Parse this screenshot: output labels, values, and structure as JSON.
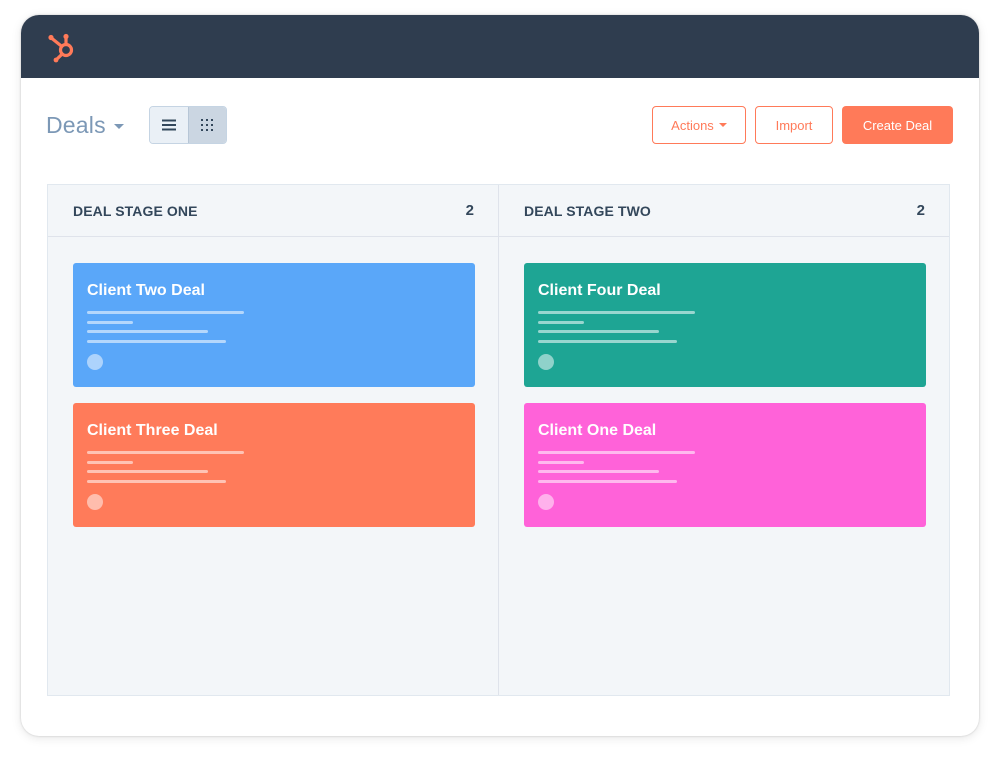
{
  "app": {
    "brand_color": "#ff7a59",
    "logo_icon": "hubspot-sprocket-icon",
    "topbar_color": "#2f3d4f"
  },
  "header": {
    "title": "Deals",
    "view_modes": [
      {
        "icon": "list-view-icon",
        "active": false
      },
      {
        "icon": "grid-view-icon",
        "active": true
      }
    ]
  },
  "toolbar": {
    "actions_label": "Actions",
    "import_label": "Import",
    "create_label": "Create Deal"
  },
  "columns": [
    {
      "title": "DEAL STAGE ONE",
      "count": "2",
      "cards": [
        {
          "title": "Client Two Deal",
          "color": "#5aa7f9"
        },
        {
          "title": "Client Three Deal",
          "color": "#ff7b5a"
        }
      ]
    },
    {
      "title": "DEAL STAGE TWO",
      "count": "2",
      "cards": [
        {
          "title": "Client Four Deal",
          "color": "#1ea594"
        },
        {
          "title": "Client One Deal",
          "color": "#ff62d9"
        }
      ]
    }
  ]
}
